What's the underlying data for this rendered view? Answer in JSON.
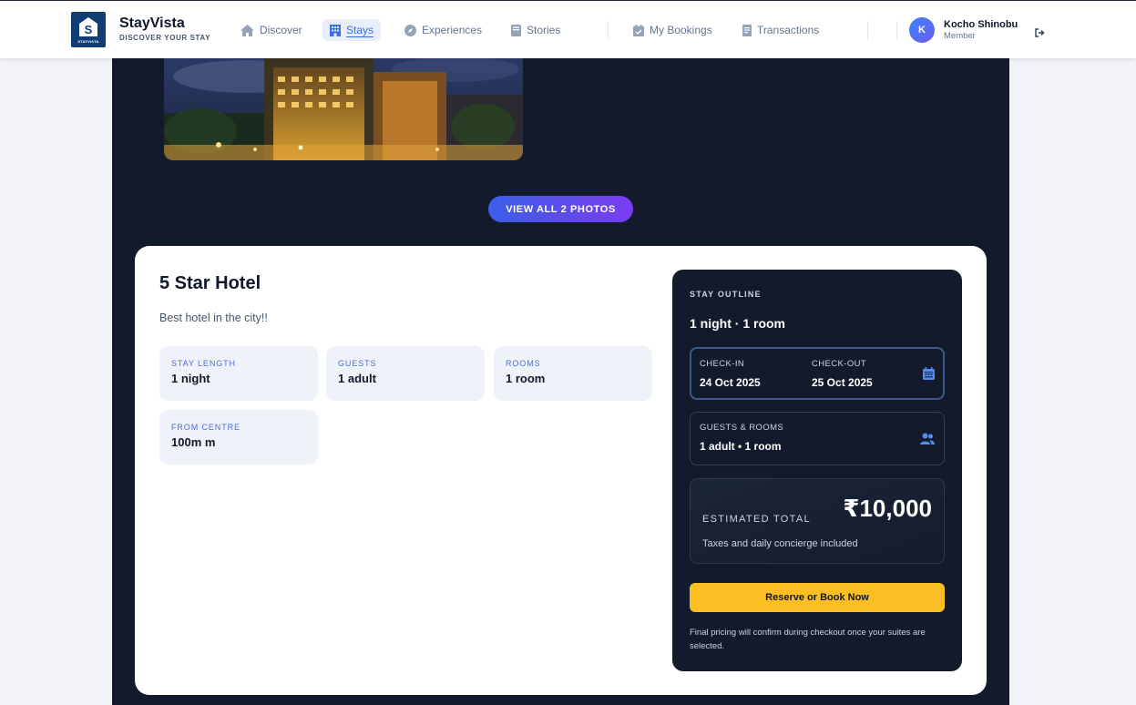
{
  "brand": {
    "name": "StayVista",
    "tagline": "DISCOVER YOUR STAY",
    "logo_text": "STAYVISTA"
  },
  "nav": {
    "links": [
      {
        "label": "Discover",
        "icon": "home-icon"
      },
      {
        "label": "Stays",
        "icon": "building-icon",
        "active": true
      },
      {
        "label": "Experiences",
        "icon": "compass-icon"
      },
      {
        "label": "Stories",
        "icon": "book-icon"
      },
      {
        "label": "My Bookings",
        "icon": "calendar-check-icon"
      },
      {
        "label": "Transactions",
        "icon": "receipt-icon"
      }
    ]
  },
  "user": {
    "initial": "K",
    "name": "Kocho Shinobu",
    "role": "Member"
  },
  "gallery": {
    "view_all_label": "VIEW ALL 2 PHOTOS"
  },
  "hotel": {
    "title": "5 Star Hotel",
    "description": "Best hotel in the city!!",
    "facts": [
      {
        "label": "STAY LENGTH",
        "value": "1 night"
      },
      {
        "label": "GUESTS",
        "value": "1 adult"
      },
      {
        "label": "ROOMS",
        "value": "1 room"
      },
      {
        "label": "FROM CENTRE",
        "value": "100m m"
      }
    ]
  },
  "outline": {
    "label": "STAY OUTLINE",
    "summary": "1 night · 1 room",
    "checkin_label": "CHECK-IN",
    "checkin_value": "24 Oct 2025",
    "checkout_label": "CHECK-OUT",
    "checkout_value": "25 Oct 2025",
    "guests_label": "GUESTS & ROOMS",
    "guests_value": "1 adult • 1 room",
    "total_label": "ESTIMATED TOTAL",
    "total_value": "₹10,000",
    "total_note": "Taxes and daily concierge included",
    "book_label": "Reserve or Book Now",
    "final_note": "Final pricing will confirm during checkout once your suites are selected."
  },
  "colors": {
    "accent": "#3b6ee8",
    "dark_panel": "#121a2b",
    "cta": "#fbbf24"
  }
}
